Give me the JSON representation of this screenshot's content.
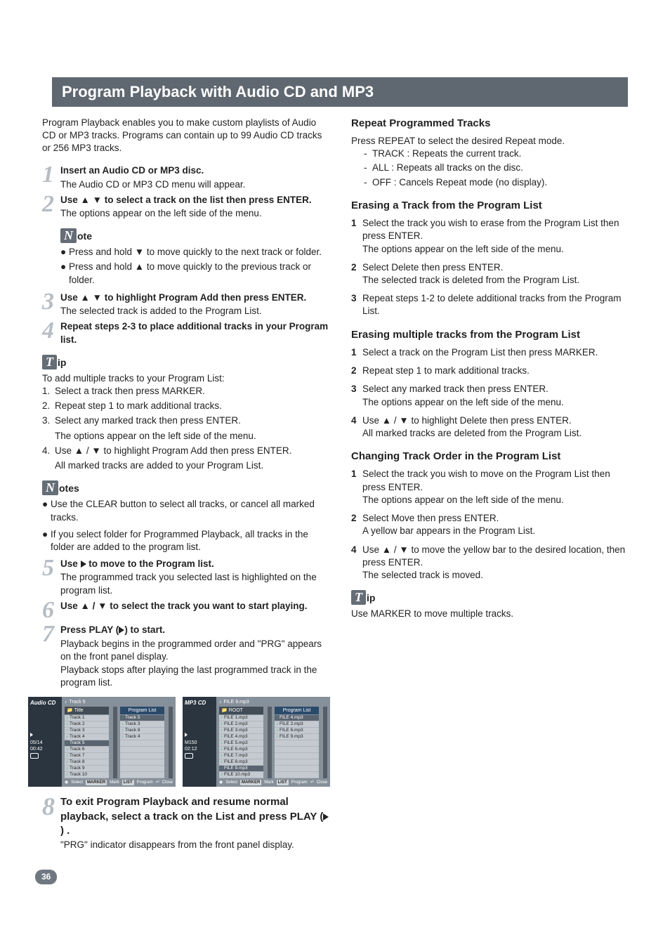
{
  "title": "Program Playback with Audio CD and MP3",
  "intro": "Program Playback enables you to make custom playlists of Audio CD or MP3 tracks. Programs can contain up to 99 Audio CD tracks or 256 MP3 tracks.",
  "left": {
    "step1": {
      "num": "1",
      "head": "Insert an Audio CD or MP3 disc.",
      "desc": "The Audio CD or MP3 CD menu will appear."
    },
    "step2": {
      "num": "2",
      "head": "Use ▲ ▼ to select a track on the list then press ENTER.",
      "desc": "The options appear on the left side of the menu."
    },
    "noteIcon": "N",
    "noteLabel": "ote",
    "note_b1": "Press and hold ▼ to move quickly to the next track or folder.",
    "note_b2": "Press and hold ▲ to move quickly to the previous track or folder.",
    "step3": {
      "num": "3",
      "head": "Use ▲ ▼ to highlight Program Add then press ENTER.",
      "desc": "The selected track is added to the Program List."
    },
    "step4": {
      "num": "4",
      "head": "Repeat steps 2-3 to place additional tracks in your Program list."
    },
    "tipIcon": "T",
    "tipLabel": "ip",
    "tipIntro": "To add multiple tracks to your Program List:",
    "tip1": "Select a track then press MARKER.",
    "tip2": "Repeat step 1 to mark additional tracks.",
    "tip3a": "Select any marked track then press ENTER.",
    "tip3b": "The options appear on the left side of the menu.",
    "tip4a": "Use ▲ / ▼ to highlight Program Add then press ENTER.",
    "tip4b": "All marked tracks are added to your Program List.",
    "notesLabel": "otes",
    "notes_b1": "Use the CLEAR button to select all tracks, or cancel all marked tracks.",
    "notes_b2": "If you select folder for Programmed Playback, all tracks in the folder are added to the program list.",
    "step5": {
      "num": "5",
      "head": "Use ▶ to move to the Program list.",
      "desc": "The programmed track you selected last is highlighted on the program list."
    },
    "step6": {
      "num": "6",
      "head": "Use ▲ / ▼ to select the track you want to start playing."
    },
    "step7": {
      "num": "7",
      "head": "Press PLAY (▶) to start.",
      "desc1": "Playback begins in the programmed order and \"PRG\" appears on the front panel display.",
      "desc2": "Playback stops after playing the last programmed track in the program list."
    },
    "step8": {
      "num": "8",
      "head": "To exit Program Playback and resume normal playback, select a track on the List and press PLAY (▶) .",
      "desc": "\"PRG\" indicator disappears from the front panel display."
    }
  },
  "right": {
    "h1": "Repeat Programmed Tracks",
    "h1_intro": "Press REPEAT to select the desired Repeat mode.",
    "h1_d1": "TRACK : Repeats the current track.",
    "h1_d2": "ALL : Repeats all tracks on the disc.",
    "h1_d3": "OFF : Cancels Repeat mode (no display).",
    "h2": "Erasing a Track from the Program List",
    "h2_s1a": "Select the track you wish to erase from the Program List then press ENTER.",
    "h2_s1b": "The options appear on the left side of the menu.",
    "h2_s2a": "Select Delete then press ENTER.",
    "h2_s2b": "The selected track is deleted from the Program List.",
    "h2_s3": "Repeat steps 1-2 to delete additional tracks from the Program List.",
    "h3": "Erasing multiple tracks from the Program List",
    "h3_s1": "Select a track on the Program List then press MARKER.",
    "h3_s2": "Repeat step 1 to mark additional tracks.",
    "h3_s3a": "Select any marked track then press ENTER.",
    "h3_s3b": "The options appear on the left side of the menu.",
    "h3_s4a": "Use ▲ / ▼ to highlight Delete then press ENTER.",
    "h3_s4b": "All marked tracks are deleted from the Program List.",
    "h4": "Changing Track Order in the Program List",
    "h4_s1a": "Select the track you wish to move on the Program List then press ENTER.",
    "h4_s1b": "The options appear on the left side of the menu.",
    "h4_s2a": "Select Move then press ENTER.",
    "h4_s2b": "A yellow bar appears in the Program List.",
    "h4_s4a": "Use ▲ / ▼ to move the yellow bar to the desired location, then press ENTER.",
    "h4_s4b": "The selected track is moved.",
    "tipIcon": "T",
    "tipLabel": "ip",
    "tipText": "Use MARKER to move multiple tracks."
  },
  "screens": {
    "audio": {
      "side_title": "Audio CD",
      "now": "Track 5",
      "counter": "05/14",
      "time": "00:42",
      "list_title": "Title",
      "prog_title": "Program List",
      "list": [
        "Track 1",
        "Track 2",
        "Track 3",
        "Track 4",
        "Track 5",
        "Track 6",
        "Track 7",
        "Track 8",
        "Track 9",
        "Track 10"
      ],
      "selIndex": 4,
      "prog": [
        "Track 5",
        "Track 3",
        "Track 8",
        "Track 4"
      ],
      "progSelIndex": 0,
      "footer": {
        "sel": "Select",
        "mk": "MARKER",
        "mkt": "Mark",
        "lst": "LIST",
        "pg": "Program",
        "cls": "Close"
      }
    },
    "mp3": {
      "side_title": "MP3 CD",
      "now": "FILE 9.mp3",
      "counter": "M150",
      "time": "02:12",
      "list_title": "ROOT",
      "prog_title": "Program List",
      "list": [
        "FILE 1.mp3",
        "FILE 2.mp3",
        "FILE 3.mp3",
        "FILE 4.mp3",
        "FILE 5.mp3",
        "FILE 6.mp3",
        "FILE 7.mp3",
        "FILE 8.mp3",
        "FILE 9.mp3",
        "FILE 10.mp3"
      ],
      "selIndex": 8,
      "prog": [
        "FILE 4.mp3",
        "FILE 2.mp3",
        "FILE 6.mp3",
        "FILE 9.mp3"
      ],
      "progSelIndex": 0,
      "footer": {
        "sel": "Select",
        "mk": "MARKER",
        "mkt": "Mark",
        "lst": "LIST",
        "pg": "Program",
        "cls": "Close"
      }
    }
  },
  "page": "36"
}
